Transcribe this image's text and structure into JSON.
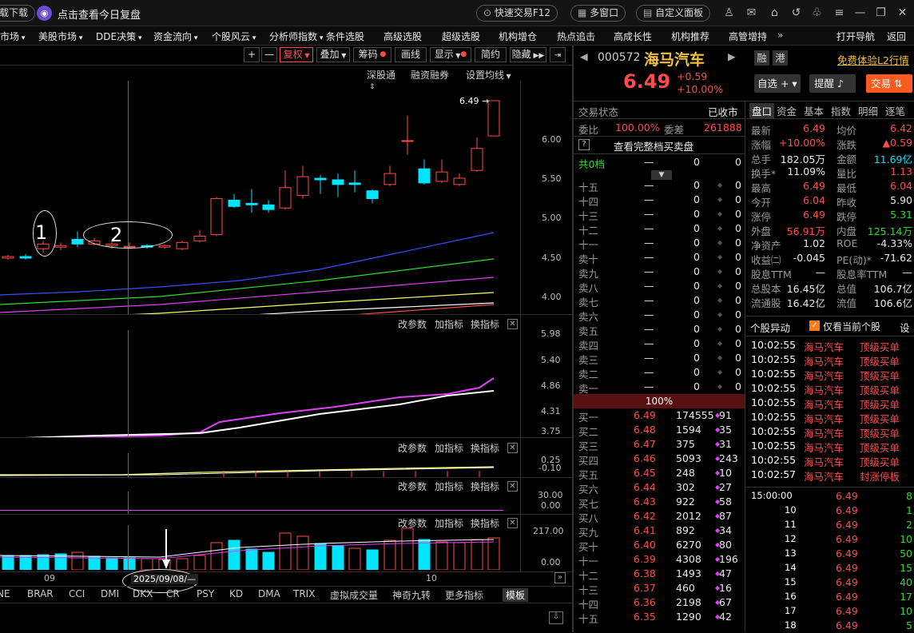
{
  "topbar": {
    "download": "载下载",
    "review": "点击查看今日复盘",
    "quick_trade": "快速交易F12",
    "multi_window": "多窗口",
    "custom_panel": "自定义面板"
  },
  "menu": [
    "市场",
    "美股市场",
    "DDE决策",
    "资金流向",
    "个股风云",
    "分析师指数",
    "条件选股",
    "高级选股",
    "超级选股",
    "机构增仓",
    "热点追击",
    "高成长性",
    "机构推荐",
    "高管增持"
  ],
  "menu_right": {
    "open_nav": "打开导航",
    "back": "返回"
  },
  "toolbar": {
    "plus": "+",
    "minus": "—",
    "fuquan": "复权",
    "diejia": "叠加",
    "chouma": "筹码",
    "huaxian": "画线",
    "xianshi": "显示",
    "jianyue": "简约",
    "yincang": "隐藏"
  },
  "main_panel": {
    "links": [
      "深股通",
      "融资融券",
      "设置均线"
    ],
    "price_marker": "6.49",
    "price_axis": [
      "6.00",
      "5.50",
      "5.00",
      "4.50",
      "4.00"
    ],
    "annotations": [
      "1",
      "2"
    ]
  },
  "indicator_panels": [
    {
      "controls": [
        "改参数",
        "加指标",
        "换指标"
      ],
      "axis": [
        "5.98",
        "5.40",
        "4.86",
        "4.31",
        "3.75"
      ]
    },
    {
      "controls": [
        "改参数",
        "加指标",
        "换指标"
      ],
      "axis": [
        "0.25",
        "-0.10"
      ]
    },
    {
      "controls": [
        "改参数",
        "加指标",
        "换指标"
      ],
      "axis": [
        "30.00",
        "0.00"
      ]
    },
    {
      "controls": [
        "改参数",
        "加指标",
        "换指标"
      ],
      "axis": [
        "217.00",
        "0.00"
      ]
    }
  ],
  "xaxis": {
    "left_month": "09",
    "right_month": "10",
    "crosshair_date": "2025/09/08/—"
  },
  "indicator_tabs": [
    "NE",
    "BRAR",
    "CCI",
    "DMI",
    "DKX",
    "CR",
    "PSY",
    "KD",
    "DMA",
    "TRIX",
    "虚拟成交量",
    "神奇九转",
    "更多指标",
    "模板"
  ],
  "stock": {
    "code": "000572",
    "name": "海马汽车",
    "price": "6.49",
    "change": "+0.59",
    "pct": "+10.00%",
    "rong": "融",
    "gang": "港",
    "l2": "免费体验L2行情",
    "zixuan": "自选",
    "tixing": "提醒",
    "jiaoyi": "交易"
  },
  "orderbook": {
    "status_label": "交易状态",
    "status_value": "已收市",
    "weibi_label": "委比",
    "weibi_value": "100.00%",
    "weicha_label": "委差",
    "weicha_value": "261888",
    "full_book": "查看完整档买卖盘",
    "gong": "共0档",
    "gong_vals": [
      "—",
      "0",
      "0"
    ],
    "sell": [
      {
        "label": "十五",
        "price": "—",
        "vol": "0",
        "n": "0"
      },
      {
        "label": "十四",
        "price": "—",
        "vol": "0",
        "n": "0"
      },
      {
        "label": "十三",
        "price": "—",
        "vol": "0",
        "n": "0"
      },
      {
        "label": "十二",
        "price": "—",
        "vol": "0",
        "n": "0"
      },
      {
        "label": "十一",
        "price": "—",
        "vol": "0",
        "n": "0"
      },
      {
        "label": "卖十",
        "price": "—",
        "vol": "0",
        "n": "0"
      },
      {
        "label": "卖九",
        "price": "—",
        "vol": "0",
        "n": "0"
      },
      {
        "label": "卖八",
        "price": "—",
        "vol": "0",
        "n": "0"
      },
      {
        "label": "卖七",
        "price": "—",
        "vol": "0",
        "n": "0"
      },
      {
        "label": "卖六",
        "price": "—",
        "vol": "0",
        "n": "0"
      },
      {
        "label": "卖五",
        "price": "—",
        "vol": "0",
        "n": "0"
      },
      {
        "label": "卖四",
        "price": "—",
        "vol": "0",
        "n": "0"
      },
      {
        "label": "卖三",
        "price": "—",
        "vol": "0",
        "n": "0"
      },
      {
        "label": "卖二",
        "price": "—",
        "vol": "0",
        "n": "0"
      },
      {
        "label": "卖一",
        "price": "—",
        "vol": "0",
        "n": "0"
      }
    ],
    "ratio": "100%",
    "buy": [
      {
        "label": "买一",
        "price": "6.49",
        "vol": "174555",
        "n": "91"
      },
      {
        "label": "买二",
        "price": "6.48",
        "vol": "1594",
        "n": "35"
      },
      {
        "label": "买三",
        "price": "6.47",
        "vol": "375",
        "n": "31"
      },
      {
        "label": "买四",
        "price": "6.46",
        "vol": "5093",
        "n": "243"
      },
      {
        "label": "买五",
        "price": "6.45",
        "vol": "248",
        "n": "10"
      },
      {
        "label": "买六",
        "price": "6.44",
        "vol": "302",
        "n": "27"
      },
      {
        "label": "买七",
        "price": "6.43",
        "vol": "922",
        "n": "58"
      },
      {
        "label": "买八",
        "price": "6.42",
        "vol": "2012",
        "n": "87"
      },
      {
        "label": "买九",
        "price": "6.41",
        "vol": "892",
        "n": "34"
      },
      {
        "label": "买十",
        "price": "6.40",
        "vol": "6270",
        "n": "80"
      },
      {
        "label": "十一",
        "price": "6.39",
        "vol": "4308",
        "n": "196"
      },
      {
        "label": "十二",
        "price": "6.38",
        "vol": "1493",
        "n": "47"
      },
      {
        "label": "十三",
        "price": "6.37",
        "vol": "460",
        "n": "16"
      },
      {
        "label": "十四",
        "price": "6.36",
        "vol": "2198",
        "n": "67"
      },
      {
        "label": "十五",
        "price": "6.35",
        "vol": "1290",
        "n": "42"
      }
    ]
  },
  "quote_tabs": [
    "盘口",
    "资金",
    "基本",
    "指数",
    "明细",
    "逐笔"
  ],
  "quote": [
    {
      "l1": "最新",
      "v1": "6.49",
      "c1": "red",
      "l2": "均价",
      "v2": "6.42",
      "c2": "red"
    },
    {
      "l1": "涨幅",
      "v1": "+10.00%",
      "c1": "red",
      "l2": "涨跌",
      "v2": "▲0.59",
      "c2": "red"
    },
    {
      "l1": "总手",
      "v1": "182.05万",
      "c1": "wht",
      "l2": "金额",
      "v2": "11.69亿",
      "c2": "cyan"
    },
    {
      "l1": "换手*",
      "v1": "11.09%",
      "c1": "wht",
      "l2": "量比",
      "v2": "1.13",
      "c2": "red"
    },
    {
      "l1": "最高",
      "v1": "6.49",
      "c1": "red",
      "l2": "最低",
      "v2": "6.04",
      "c2": "red"
    },
    {
      "l1": "今开",
      "v1": "6.04",
      "c1": "red",
      "l2": "昨收",
      "v2": "5.90",
      "c2": "wht"
    },
    {
      "l1": "涨停",
      "v1": "6.49",
      "c1": "red",
      "l2": "跌停",
      "v2": "5.31",
      "c2": "grn"
    },
    {
      "l1": "外盘",
      "v1": "56.91万",
      "c1": "red",
      "l2": "内盘",
      "v2": "125.14万",
      "c2": "grn"
    },
    {
      "l1": "净资产",
      "v1": "1.02",
      "c1": "wht",
      "l2": "ROE",
      "v2": "-4.33%",
      "c2": "wht"
    },
    {
      "l1": "收益㈡",
      "v1": "-0.045",
      "c1": "wht",
      "l2": "PE(动)*",
      "v2": "-71.62",
      "c2": "wht"
    },
    {
      "l1": "股息TTM",
      "v1": "—",
      "c1": "wht",
      "l2": "股息率TTM",
      "v2": "—",
      "c2": "wht"
    },
    {
      "l1": "总股本",
      "v1": "16.45亿",
      "c1": "wht",
      "l2": "总值",
      "v2": "106.7亿",
      "c2": "wht"
    },
    {
      "l1": "流通股",
      "v1": "16.42亿",
      "c1": "wht",
      "l2": "流值",
      "v2": "106.6亿",
      "c2": "wht"
    }
  ],
  "alerts": {
    "title": "个股异动",
    "only_current": "仅看当前个股",
    "settings": "设",
    "rows": [
      {
        "time": "10:02:55",
        "name": "海马汽车",
        "type": "顶级买单"
      },
      {
        "time": "10:02:55",
        "name": "海马汽车",
        "type": "顶级买单"
      },
      {
        "time": "10:02:55",
        "name": "海马汽车",
        "type": "顶级买单"
      },
      {
        "time": "10:02:55",
        "name": "海马汽车",
        "type": "顶级买单"
      },
      {
        "time": "10:02:55",
        "name": "海马汽车",
        "type": "顶级买单"
      },
      {
        "time": "10:02:55",
        "name": "海马汽车",
        "type": "顶级买单"
      },
      {
        "time": "10:02:55",
        "name": "海马汽车",
        "type": "顶级买单"
      },
      {
        "time": "10:02:55",
        "name": "海马汽车",
        "type": "顶级买单"
      },
      {
        "time": "10:02:55",
        "name": "海马汽车",
        "type": "顶级买单"
      },
      {
        "time": "10:02:57",
        "name": "海马汽车",
        "type": "封涨停板"
      }
    ]
  },
  "ticks": [
    {
      "t": "15:00:00",
      "p": "6.49",
      "v": "8"
    },
    {
      "t": "10",
      "p": "6.49",
      "v": "1"
    },
    {
      "t": "11",
      "p": "6.49",
      "v": "2"
    },
    {
      "t": "12",
      "p": "6.49",
      "v": "10"
    },
    {
      "t": "13",
      "p": "6.49",
      "v": "50"
    },
    {
      "t": "14",
      "p": "6.49",
      "v": "15"
    },
    {
      "t": "15",
      "p": "6.49",
      "v": "40"
    },
    {
      "t": "16",
      "p": "6.49",
      "v": "17"
    },
    {
      "t": "17",
      "p": "6.49",
      "v": "10"
    },
    {
      "t": "18",
      "p": "6.49",
      "v": "5"
    }
  ],
  "colors": {
    "up": "#ff4b4b",
    "down": "#00e5ff",
    "ma5": "#ffffff",
    "ma10": "#e040fb",
    "ma20": "#2bdc2b",
    "bg": "#000000"
  }
}
